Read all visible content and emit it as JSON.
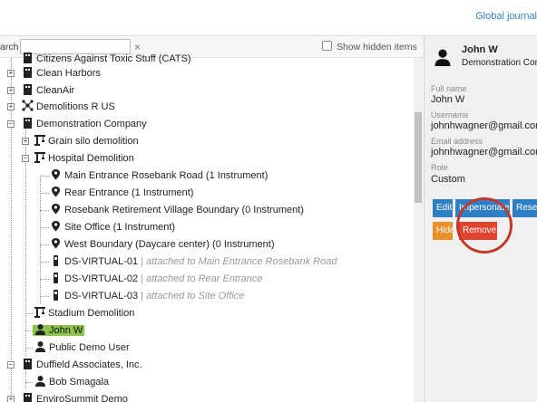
{
  "header": {
    "link": "Global journal"
  },
  "search": {
    "label": "arch",
    "value": "",
    "clear": "×",
    "show_hidden": "Show hidden items"
  },
  "tree": [
    {
      "label": "Citizens Against Toxic Stuff (CATS)",
      "icon": "building-icon"
    },
    {
      "label": "Clean Harbors",
      "icon": "building-icon"
    },
    {
      "label": "CleanAir",
      "icon": "building-icon"
    },
    {
      "label": "Demolitions R US",
      "icon": "network-icon"
    },
    {
      "label": "Demonstration Company",
      "icon": "building-icon"
    },
    {
      "label": "Grain silo demolition",
      "icon": "crane-icon"
    },
    {
      "label": "Hospital Demolition",
      "icon": "crane-icon"
    },
    {
      "label": "Main Entrance Rosebank Road (1 Instrument)",
      "icon": "map-pin-icon"
    },
    {
      "label": "Rear Entrance (1 Instrument)",
      "icon": "map-pin-icon"
    },
    {
      "label": "Rosebank Retirement Village Boundary (0 Instrument)",
      "icon": "map-pin-icon"
    },
    {
      "label": "Site Office (1 Instrument)",
      "icon": "map-pin-icon"
    },
    {
      "label": "West Boundary (Daycare center) (0 Instrument)",
      "icon": "map-pin-icon"
    },
    {
      "label": "DS-VIRTUAL-01",
      "sep": " | ",
      "sub": "attached to Main Entrance Rosebank Road",
      "icon": "device-icon"
    },
    {
      "label": "DS-VIRTUAL-02",
      "sep": " | ",
      "sub": "attached to Rear Entrance",
      "icon": "device-icon"
    },
    {
      "label": "DS-VIRTUAL-03",
      "sep": " | ",
      "sub": "attached to Site Office",
      "icon": "device-icon"
    },
    {
      "label": "Stadium Demolition",
      "icon": "crane-icon"
    },
    {
      "label": "John W",
      "icon": "user-icon"
    },
    {
      "label": "Public Demo User",
      "icon": "user-icon"
    },
    {
      "label": "Duffield Associates, Inc.",
      "icon": "building-icon"
    },
    {
      "label": "Bob Smagala",
      "icon": "user-icon"
    },
    {
      "label": "EnviroSummit Demo",
      "icon": "building-icon"
    }
  ],
  "detail": {
    "name": "John W",
    "company": "Demonstration Company",
    "fields": {
      "full_name_label": "Full name",
      "full_name": "John W",
      "username_label": "Username",
      "username": "johnhwagner@gmail.com",
      "email_label": "Email address",
      "email": "johnhwagner@gmail.com",
      "role_label": "Role",
      "role": "Custom"
    },
    "buttons": {
      "edit": "Edit",
      "impersonate": "Impersonate",
      "reset": "Reset",
      "hide": "Hide",
      "remove": "Remove"
    }
  },
  "colors": {
    "accent": "#2f7fc4",
    "selected": "#8bc34a",
    "remove": "#e0442c",
    "hide": "#e8902a",
    "highlight_circle": "#c0392b"
  }
}
